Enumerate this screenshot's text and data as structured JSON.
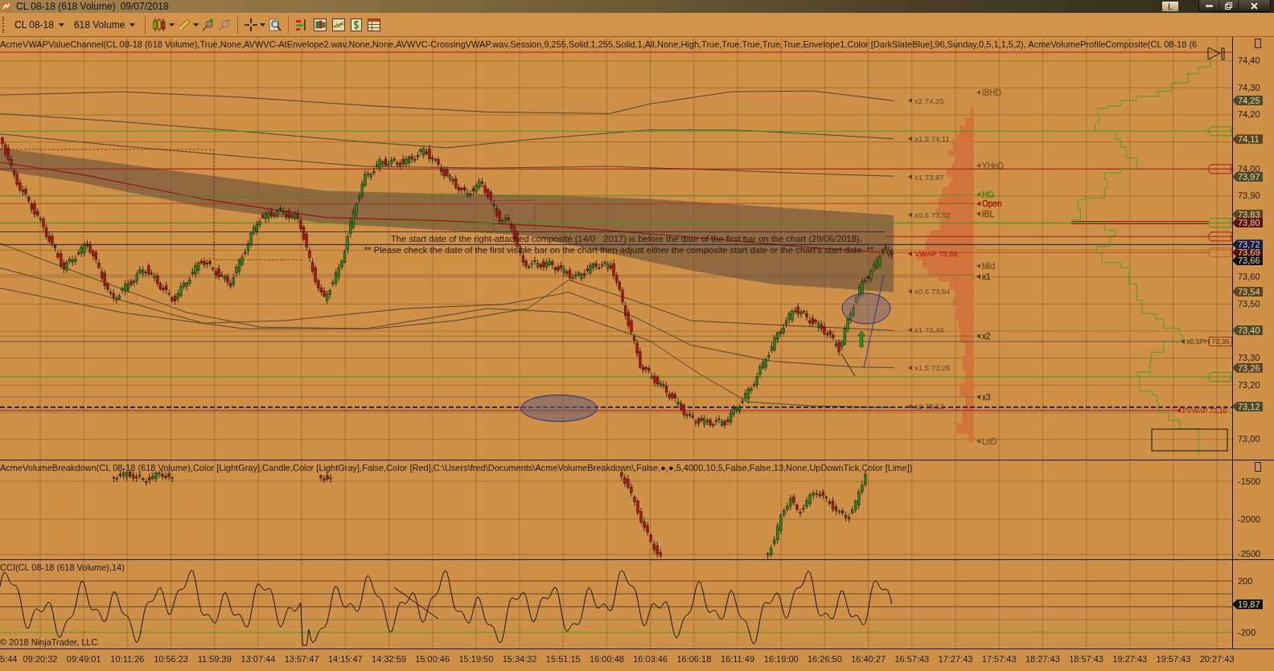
{
  "window": {
    "title": "CL 08-18 (618 Volume)",
    "date": "09/07/2018",
    "layout_button": "L"
  },
  "toolbar": {
    "instrument": "CL 08-18",
    "interval": "618 Volume"
  },
  "price_panel": {
    "indicator_label": "AcmeVWAPValueChannel(CL 08-18 (618 Volume),True,None,AVWVC-AtEnvelope2.wav,None,None,AVWVC-CrossingVWAP.wav,Session,9,255,Solid,1,255,Solid,1,All,None,High,True,True,True,True,True,Envelope1,Color [DarkSlateBlue],96,Sunday,0,5,1,1,5,2), AcmeVolumeProfileComposite(CL 08-18 (6",
    "warning": {
      "line_1": [
        "The start date of the right-attached composite (14/0",
        "2017) is before the date of the first bar on the chart (29/06/2018)."
      ],
      "line_2": "** Please check the date of the first visible bar on the chart then adjust either the composite start date or the chart's start date. **"
    },
    "band_labels": [
      {
        "text": "x2 74,25",
        "color": "#5a4830"
      },
      {
        "text": "x1,5 74,11",
        "color": "#5a4830"
      },
      {
        "text": "x1 73,97",
        "color": "#5a4830"
      },
      {
        "text": "x0,5 73,83",
        "color": "#5a4830"
      },
      {
        "text": "VWAP 73,69",
        "color": "#b01010"
      },
      {
        "text": "x0,5 73,54",
        "color": "#5a4830"
      },
      {
        "text": "x1 73,40",
        "color": "#5a4830"
      },
      {
        "text": "x1,5 73,26",
        "color": "#5a4830"
      },
      {
        "text": "x2 73,12",
        "color": "#5a4830"
      }
    ],
    "profile_labels": [
      {
        "text": "IBHD",
        "color": "#7a5428"
      },
      {
        "text": "YHoD",
        "color": "#7a5428"
      },
      {
        "text": "HG",
        "color": "#2a8a1a"
      },
      {
        "text": "Open",
        "color": "#a01808"
      },
      {
        "text": "IBL",
        "color": "#7a4408"
      },
      {
        "text": "Mid",
        "color": "#7a5428"
      },
      {
        "text": "x1",
        "color": "#4a3820"
      },
      {
        "text": "x2",
        "color": "#4a3820"
      },
      {
        "text": "x3",
        "color": "#4a3820"
      },
      {
        "text": "LoD",
        "color": "#7a5428"
      }
    ],
    "ph_label": "x0,5PH",
    "ph_price": "73,36",
    "pvwap_label": "PVWAP 73,10",
    "axis_ticks": [
      "74,40",
      "74,30",
      "74,20",
      "74,00",
      "73,90",
      "73,60",
      "73,50",
      "73,30",
      "73,20",
      "73,00"
    ],
    "price_tags": [
      {
        "label": "74,25",
        "color": "#4d4a2c"
      },
      {
        "label": "74,11",
        "color": "#5c4322"
      },
      {
        "label": "73,97",
        "color": "#4d4a2c"
      },
      {
        "label": "73,83",
        "color": "#5c4322"
      },
      {
        "label": "73,80",
        "color": "#5a1010"
      },
      {
        "label": "73,72",
        "color": "#141c4c"
      },
      {
        "label": "73,69",
        "color": "#5a1010"
      },
      {
        "label": "73,66",
        "color": "#111111"
      },
      {
        "label": "73,54",
        "color": "#5c4322"
      },
      {
        "label": "73,40",
        "color": "#4d4a2c"
      },
      {
        "label": "73,26",
        "color": "#5c4322"
      },
      {
        "label": "73,12",
        "color": "#4d4a2c"
      }
    ]
  },
  "volume_panel": {
    "indicator_label": "AcmeVolumeBreakdown(CL 08-18 (618 Volume),Color [LightGray],Candle,Color [LightGray],False,Color [Red],C:\\Users\\fred\\Documents\\AcmeVolumeBreakdown\\,False,●,●,5,4000,10,5,False,False,13,None,UpDownTick,Color [Lime])",
    "axis_ticks": [
      "-1500",
      "-2000",
      "-2500"
    ]
  },
  "cci_panel": {
    "indicator_label": "CCI(CL 08-18 (618 Volume),14)",
    "axis_ticks": [
      "200",
      "-200"
    ],
    "value_tag": "19,87",
    "copyright": "© 2018 NinjaTrader, LLC"
  },
  "time_axis": {
    "labels": [
      "5:44",
      "09:20:32",
      "09:49:01",
      "10:11:26",
      "10:56:23",
      "11:59:39",
      "13:07:44",
      "13:57:47",
      "14:15:47",
      "14:32:59",
      "15:00:46",
      "15:19:50",
      "15:34:32",
      "15:51:15",
      "16:00:48",
      "16:03:46",
      "16:06:18",
      "16:11:49",
      "16:19:00",
      "16:26:50",
      "16:40:27",
      "16:57:43",
      "17:27:43",
      "17:57:43",
      "18:27:43",
      "18:57:43",
      "19:27:43",
      "19:57:43",
      "20:27:43"
    ]
  }
}
